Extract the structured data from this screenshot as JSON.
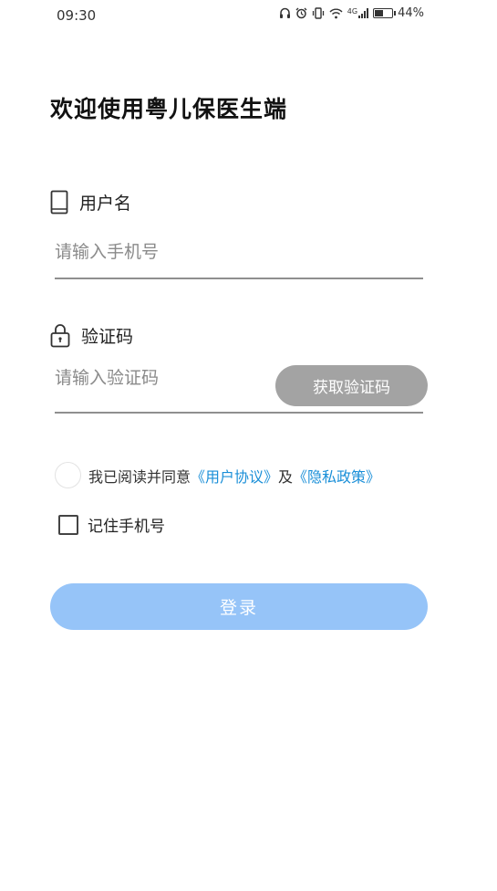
{
  "status_bar": {
    "time": "09:30",
    "battery_percent": "44%",
    "network_label": "4G",
    "icons": [
      "headphones-icon",
      "alarm-icon",
      "vibrate-icon",
      "wifi-icon",
      "signal-icon",
      "battery-icon"
    ]
  },
  "title": "欢迎使用粤儿保医生端",
  "username": {
    "label": "用户名",
    "icon": "phone-icon",
    "placeholder": "请输入手机号",
    "value": ""
  },
  "code": {
    "label": "验证码",
    "icon": "lock-icon",
    "placeholder": "请输入验证码",
    "value": "",
    "button_label": "获取验证码"
  },
  "agreement": {
    "prefix": "我已阅读并同意",
    "user_agreement": "《用户协议》",
    "and": "及",
    "privacy_policy": "《隐私政策》",
    "checked": false
  },
  "remember": {
    "label": "记住手机号",
    "checked": false
  },
  "login_button": "登录",
  "colors": {
    "link": "#1a8fd8",
    "login_button_bg": "#96c4f8",
    "code_button_bg": "#a3a3a3"
  }
}
